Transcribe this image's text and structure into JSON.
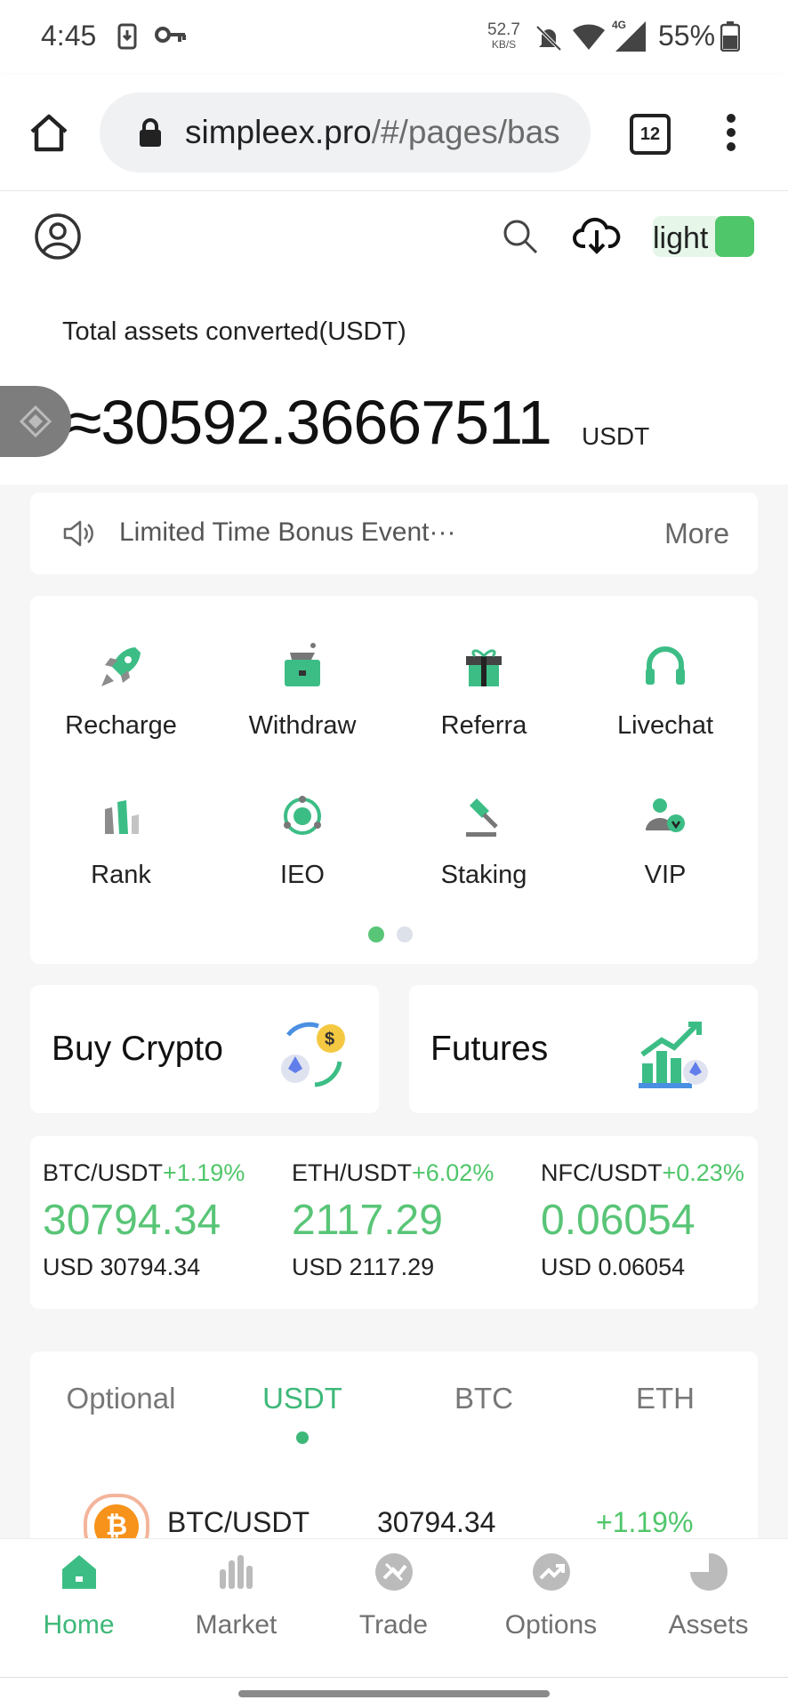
{
  "status_bar": {
    "time": "4:45",
    "net_speed_value": "52.7",
    "net_speed_unit": "KB/S",
    "network": "4G",
    "battery": "55%"
  },
  "browser": {
    "url_host": "simpleex.pro",
    "url_path": "/#/pages/bas",
    "tab_count": "12"
  },
  "header": {
    "theme_label": "light",
    "accent": "#4fc66a"
  },
  "assets": {
    "label": "Total assets converted(USDT)",
    "value": "≈30592.36667511",
    "unit": "USDT"
  },
  "notice": {
    "text": "Limited Time Bonus Event···",
    "more": "More"
  },
  "grid": {
    "items": [
      {
        "label": "Recharge",
        "icon": "rocket-icon"
      },
      {
        "label": "Withdraw",
        "icon": "wallet-icon"
      },
      {
        "label": "Referra",
        "icon": "gift-icon"
      },
      {
        "label": "Livechat",
        "icon": "headset-icon"
      },
      {
        "label": "Rank",
        "icon": "rank-bars-icon"
      },
      {
        "label": "IEO",
        "icon": "ieo-orbit-icon"
      },
      {
        "label": "Staking",
        "icon": "hammer-icon"
      },
      {
        "label": "VIP",
        "icon": "vip-user-icon"
      }
    ]
  },
  "promos": {
    "buy": "Buy Crypto",
    "futures": "Futures"
  },
  "tickers": [
    {
      "pair": "BTC/USDT",
      "change": "+1.19%",
      "price": "30794.34",
      "usd": "USD 30794.34"
    },
    {
      "pair": "ETH/USDT",
      "change": "+6.02%",
      "price": "2117.29",
      "usd": "USD 2117.29"
    },
    {
      "pair": "NFC/USDT",
      "change": "+0.23%",
      "price": "0.06054",
      "usd": "USD 0.06054"
    }
  ],
  "market": {
    "tabs": [
      "Optional",
      "USDT",
      "BTC",
      "ETH"
    ],
    "active_tab": "USDT",
    "row": {
      "pair": "BTC/USDT",
      "price": "30794.34",
      "change": "+1.19%"
    }
  },
  "nav": {
    "items": [
      "Home",
      "Market",
      "Trade",
      "Options",
      "Assets"
    ],
    "active": "Home"
  }
}
